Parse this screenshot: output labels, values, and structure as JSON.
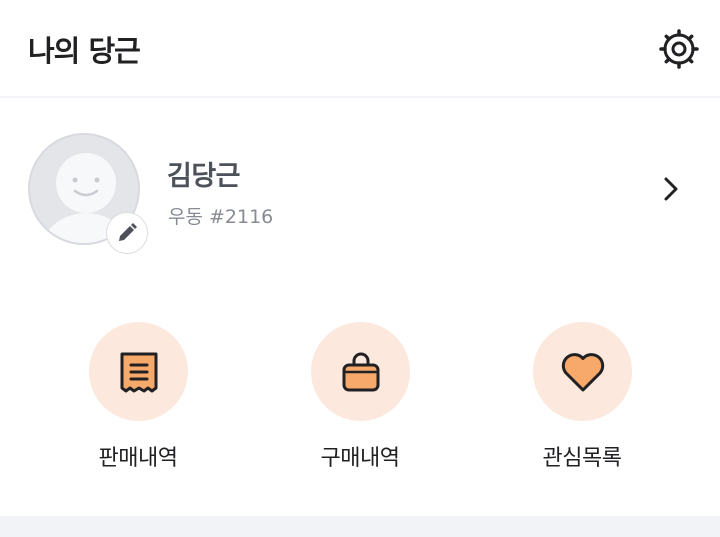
{
  "header": {
    "title": "나의 당근",
    "settings_icon": "settings-gear-icon"
  },
  "profile": {
    "name": "김당근",
    "location": "우동 #2116",
    "avatar_icon": "default-avatar-icon",
    "edit_icon": "pencil-icon",
    "chevron_icon": "chevron-right-icon"
  },
  "menu": {
    "items": [
      {
        "label": "판매내역",
        "icon": "receipt-icon"
      },
      {
        "label": "구매내역",
        "icon": "shopping-bag-icon"
      },
      {
        "label": "관심목록",
        "icon": "heart-icon"
      }
    ]
  },
  "colors": {
    "accent": "#f7a86b",
    "accent_light": "#fce8dc",
    "icon_stroke": "#212124",
    "divider": "#f2f3f6"
  }
}
